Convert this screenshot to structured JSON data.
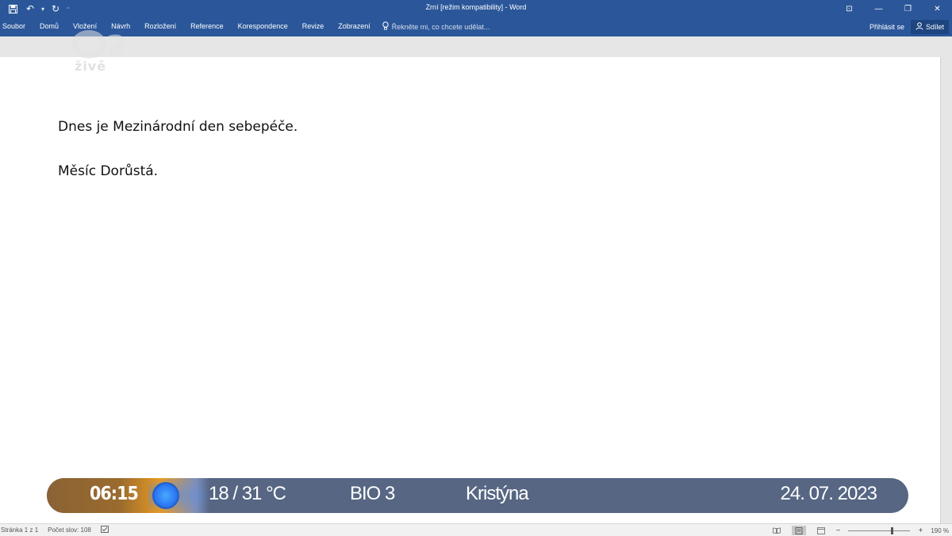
{
  "window": {
    "title": "Zrní [režim kompatibility] - Word",
    "controls": {
      "ribbon_display": "⊡",
      "minimize": "—",
      "restore": "❐",
      "close": "✕"
    }
  },
  "quick_access": {
    "save": "💾",
    "undo": "↶",
    "undo_dropdown": "▾",
    "redo": "↻",
    "customize": "⁼"
  },
  "ribbon": {
    "tabs": [
      "Soubor",
      "Domů",
      "Vložení",
      "Návrh",
      "Rozložení",
      "Reference",
      "Korespondence",
      "Revize",
      "Zobrazení"
    ],
    "tell_me": "Řekněte mi, co chcete udělat...",
    "sign_in": "Přihlásit se",
    "share": "Sdílet"
  },
  "document": {
    "paragraphs": [
      "Dnes je Mezinárodní den sebepéče.",
      "Měsíc Dorůstá."
    ]
  },
  "watermark": {
    "logo": "2",
    "label": "živě"
  },
  "overlay": {
    "time": "06:15",
    "temperature": "18 / 31 °C",
    "bio": "BIO 3",
    "nameday": "Kristýna",
    "date": "24. 07. 2023"
  },
  "statusbar": {
    "page": "Stránka 1 z 1",
    "words": "Počet slov: 108",
    "zoom": "190 %",
    "zoom_fraction": 0.72
  },
  "colors": {
    "ribbon": "#2b579a",
    "overlay_bar": "#566683"
  }
}
